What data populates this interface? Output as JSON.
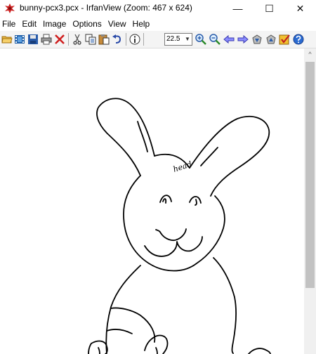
{
  "window": {
    "title": "bunny-pcx3.pcx - IrfanView (Zoom: 467 x 624)",
    "controls": {
      "minimize": "—",
      "maximize": "☐",
      "close": "✕"
    }
  },
  "menu": {
    "items": [
      "File",
      "Edit",
      "Image",
      "Options",
      "View",
      "Help"
    ]
  },
  "toolbar": {
    "zoom_value": "22.5",
    "icons": [
      "open-folder-icon",
      "slideshow-icon",
      "save-icon",
      "print-icon",
      "delete-icon",
      "cut-icon",
      "copy-icon",
      "paste-icon",
      "undo-icon",
      "info-icon",
      "zoom-in-icon",
      "zoom-out-icon",
      "previous-icon",
      "next-icon",
      "first-file-icon",
      "last-file-icon",
      "options-icon",
      "help-icon"
    ]
  },
  "image": {
    "annotation": "head"
  },
  "scrollbar": {
    "up_arrow": "^"
  }
}
